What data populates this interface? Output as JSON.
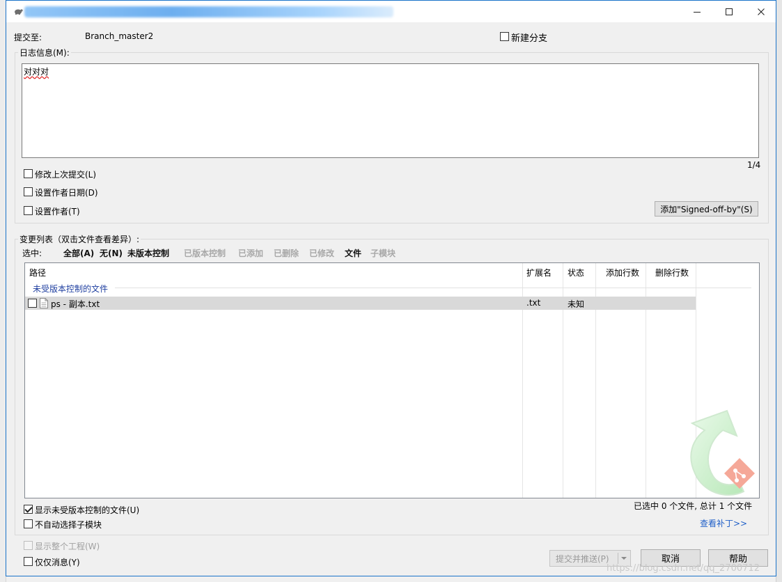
{
  "window": {
    "minimize_label": "",
    "maximize_label": "",
    "close_label": ""
  },
  "header": {
    "commit_to_label": "提交至:",
    "branch_name": "Branch_master2",
    "new_branch_label": "新建分支"
  },
  "log": {
    "group_label": "日志信息(M):",
    "message": "对对对",
    "counter": "1/4",
    "amend_label": "修改上次提交(L)",
    "set_date_label": "设置作者日期(D)",
    "set_author_label": "设置作者(T)",
    "signed_off_label": "添加\"Signed-off-by\"(S)"
  },
  "changes": {
    "group_label": "变更列表（双击文件查看差异）:",
    "select_label": "选中:",
    "filters": [
      {
        "label": "全部(A)",
        "active": true
      },
      {
        "label": "无(N)",
        "active": true
      },
      {
        "label": "未版本控制",
        "active": true
      },
      {
        "label": "已版本控制",
        "active": false
      },
      {
        "label": "已添加",
        "active": false
      },
      {
        "label": "已删除",
        "active": false
      },
      {
        "label": "已修改",
        "active": false
      },
      {
        "label": "文件",
        "active": true
      },
      {
        "label": "子模块",
        "active": false
      }
    ],
    "columns": {
      "path": "路径",
      "ext": "扩展名",
      "status": "状态",
      "added": "添加行数",
      "deleted": "删除行数"
    },
    "group_row": "未受版本控制的文件",
    "rows": [
      {
        "path": "ps - 副本.txt",
        "ext": ".txt",
        "status": "未知",
        "added": "",
        "deleted": ""
      }
    ],
    "summary": "已选中 0 个文件, 总计 1 个文件",
    "view_patch": "查看补丁>>",
    "show_unversioned_label": "显示未受版本控制的文件(U)",
    "no_auto_submodule_label": "不自动选择子模块"
  },
  "footer": {
    "show_project_label": "显示整个工程(W)",
    "message_only_label": "仅仅消息(Y)",
    "commit_push_label": "提交并推送(P)",
    "cancel_label": "取消",
    "help_label": "帮助",
    "watermark": "https://blog.csdn.net/qq_2700712"
  },
  "colors": {
    "titlebar_border": "#1a73c9",
    "link": "#1f5fc8",
    "disabled_text": "#a8a8a8"
  }
}
